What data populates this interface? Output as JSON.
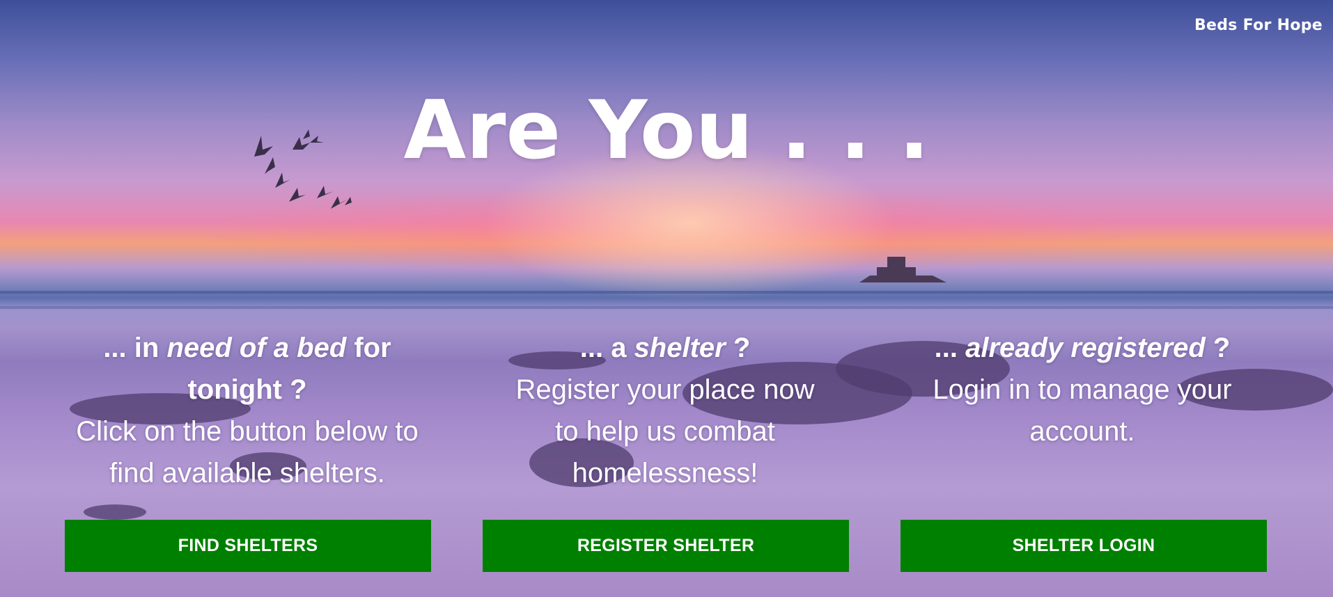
{
  "header": {
    "site_title": "Beds For Hope"
  },
  "hero": {
    "headline": "Are You . . ."
  },
  "columns": [
    {
      "q_prefix": "... in ",
      "q_emphasis": "need of a bed",
      "q_suffix_1": " for",
      "q_line2": "tonight ?",
      "desc": "Click on the button below to find available shelters.",
      "button_label": "FIND SHELTERS"
    },
    {
      "q_prefix": "... a ",
      "q_emphasis": "shelter",
      "q_suffix_1": " ?",
      "desc": "Register your place now to help us combat homelessness!",
      "button_label": "REGISTER SHELTER"
    },
    {
      "q_prefix": "... ",
      "q_emphasis": "already registered",
      "q_suffix_1": " ?",
      "desc": "Login in to manage your account.",
      "button_label": "SHELTER LOGIN"
    }
  ],
  "colors": {
    "button_bg": "#008000",
    "text": "#ffffff"
  }
}
